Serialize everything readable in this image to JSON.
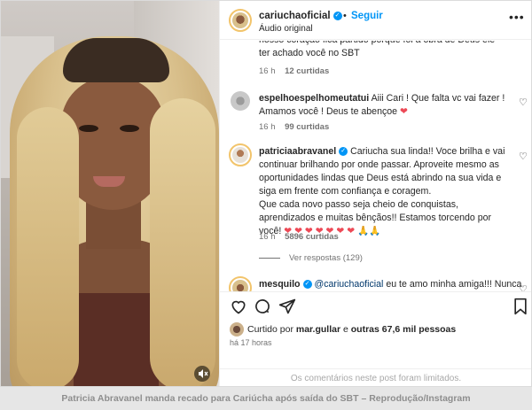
{
  "header": {
    "username": "cariuchaoficial",
    "dot": "•",
    "follow_label": "Seguir",
    "audio_label": "Áudio original",
    "more_icon": "more-horizontal-icon"
  },
  "comments": [
    {
      "text": "nosso coração fica partido porque foi a obra de Deus ele ter achado você no SBT",
      "time": "16 h",
      "likes": "12 curtidas"
    },
    {
      "username": "espelhoespelhomeutatui",
      "text": "Aiii Cari ! Que falta vc vai fazer ! Amamos você ! Deus te abençoe",
      "emoji": "❤",
      "time": "16 h",
      "likes": "99 curtidas"
    },
    {
      "username": "patriciaabravanel",
      "text_lines": [
        "Cariucha sua linda!! Voce brilha e vai continuar brilhando por onde passar. Aproveite mesmo as oportunidades lindas que Deus está abrindo na sua vida e siga em frente com confiança e coragem.",
        "Que cada novo passo seja cheio de conquistas, aprendizados e muitas bênçãos!! Estamos torcendo por você!"
      ],
      "hearts_inline": "❤ ❤ ❤ ❤ ❤",
      "hearts_line2": "❤ ❤",
      "praying": "🙏🙏",
      "time": "16 h",
      "likes": "5896 curtidas",
      "replies_label": "Ver respostas (129)"
    },
    {
      "username": "mesquilo",
      "mention": "@cariuchaoficial",
      "text": "eu te amo minha amiga!!! Nunca"
    }
  ],
  "actions": {
    "like_icon": "heart-icon",
    "comment_icon": "comment-icon",
    "share_icon": "share-icon",
    "save_icon": "bookmark-icon",
    "liked_prefix": "Curtido por",
    "liked_user": "mar.gullar",
    "liked_conj": "e",
    "liked_others": "outras 67,6 mil pessoas",
    "time_ago": "há 17 horas",
    "limited_notice": "Os comentários neste post foram limitados."
  },
  "caption": "Patricia Abravanel manda recado para Cariúcha após saída do SBT – Reprodução/Instagram",
  "colors": {
    "link_blue": "#0095f6",
    "mention_blue": "#00376b",
    "heart_red": "#ed4956",
    "muted_gray": "#737373"
  }
}
